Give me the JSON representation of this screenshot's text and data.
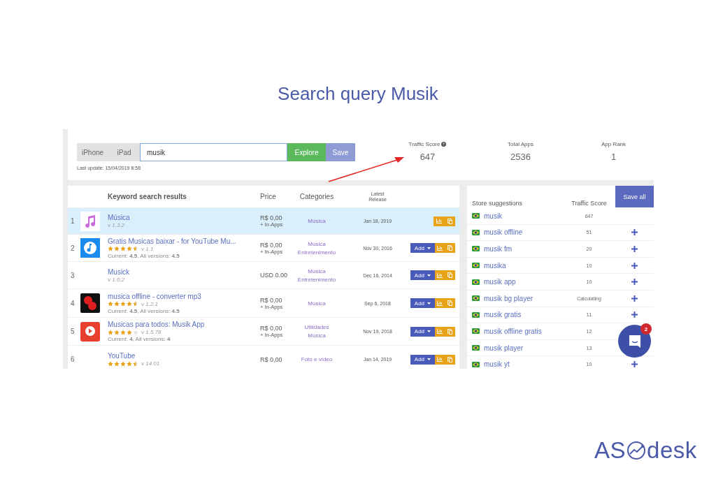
{
  "title": "Search query Musik",
  "search": {
    "devices": [
      {
        "label": "iPhone",
        "selected": false
      },
      {
        "label": "iPad",
        "selected": false
      }
    ],
    "value": "musik",
    "explore": "Explore",
    "save": "Save",
    "last_update": "Last update: 15/04/2019 8:58"
  },
  "stats": [
    {
      "label": "Traffic Score",
      "help": true,
      "value": "647"
    },
    {
      "label": "Total Apps",
      "help": false,
      "value": "2536"
    },
    {
      "label": "App Rank",
      "help": false,
      "value": "1"
    }
  ],
  "results": {
    "columns": [
      "Keyword search results",
      "Price",
      "Categories",
      "Latest Release"
    ],
    "rows": [
      {
        "rank": "1",
        "name": "Música",
        "version": "v 1.3.2",
        "price": "R$ 0,00",
        "in_apps": "+ In-Apps",
        "categories": [
          "Música"
        ],
        "date": "Jan 18, 2019",
        "selected": true,
        "add": null
      },
      {
        "rank": "2",
        "name": "Gratis Musicas baixar - for YouTube Mu...",
        "stars": 4.5,
        "version": "v 1.1",
        "rating": "Current: **4.5**, All versions: **4.5**",
        "price": "R$ 0,00",
        "in_apps": "+ In-Apps",
        "categories": [
          "Música",
          "Entretenimento"
        ],
        "date": "Nov 30, 2016",
        "selected": false,
        "add": "Add"
      },
      {
        "rank": "3",
        "name": "Musick",
        "version": "v 1.0.2",
        "price": "USD 0.00",
        "categories": [
          "Música",
          "Entretenimento"
        ],
        "date": "Dec 16, 2014",
        "selected": false,
        "add": "Add"
      },
      {
        "rank": "4",
        "name": "musica offline - converter mp3",
        "stars": 4.5,
        "version": "v 1.2.1",
        "rating": "Current: **4.5**, All versions: **4.5**",
        "price": "R$ 0,00",
        "in_apps": "+ In-Apps",
        "categories": [
          "Música"
        ],
        "date": "Sep 6, 2018",
        "selected": false,
        "add": "Add"
      },
      {
        "rank": "5",
        "name": "Musicas para todos: Musik App",
        "stars": 4,
        "version": "v 1.5.78",
        "rating": "Current: **4**, All versions: **4**",
        "price": "R$ 0,00",
        "in_apps": "+ In-Apps",
        "categories": [
          "Utilidades",
          "Música"
        ],
        "date": "Nov 19, 2018",
        "selected": false,
        "add": "Add"
      },
      {
        "rank": "6",
        "name": "YouTube",
        "stars": 4.5,
        "version": "v 14.01",
        "price": "R$ 0,00",
        "categories": [
          "Foto e vídeo"
        ],
        "date": "Jan 14, 2019",
        "selected": false,
        "add": "Add"
      }
    ]
  },
  "suggestions": {
    "columns": [
      "Store suggestions",
      "Traffic Score"
    ],
    "save_all": "Save all",
    "rows": [
      {
        "keyword": "musik",
        "score": "647",
        "addable": false
      },
      {
        "keyword": "musik offline",
        "score": "51",
        "addable": true
      },
      {
        "keyword": "musik fm",
        "score": "20",
        "addable": true
      },
      {
        "keyword": "musika",
        "score": "10",
        "addable": true
      },
      {
        "keyword": "musik app",
        "score": "10",
        "addable": true
      },
      {
        "keyword": "musik bg player",
        "score": "Calculating",
        "addable": true
      },
      {
        "keyword": "musik gratis",
        "score": "11",
        "addable": true
      },
      {
        "keyword": "musik offline gratis",
        "score": "12"
      },
      {
        "keyword": "musik player",
        "score": "13"
      },
      {
        "keyword": "musik yt",
        "score": "10",
        "addable": true
      }
    ]
  },
  "chat": {
    "badge": "2"
  },
  "logo": {
    "left": "AS",
    "right": "desk"
  }
}
